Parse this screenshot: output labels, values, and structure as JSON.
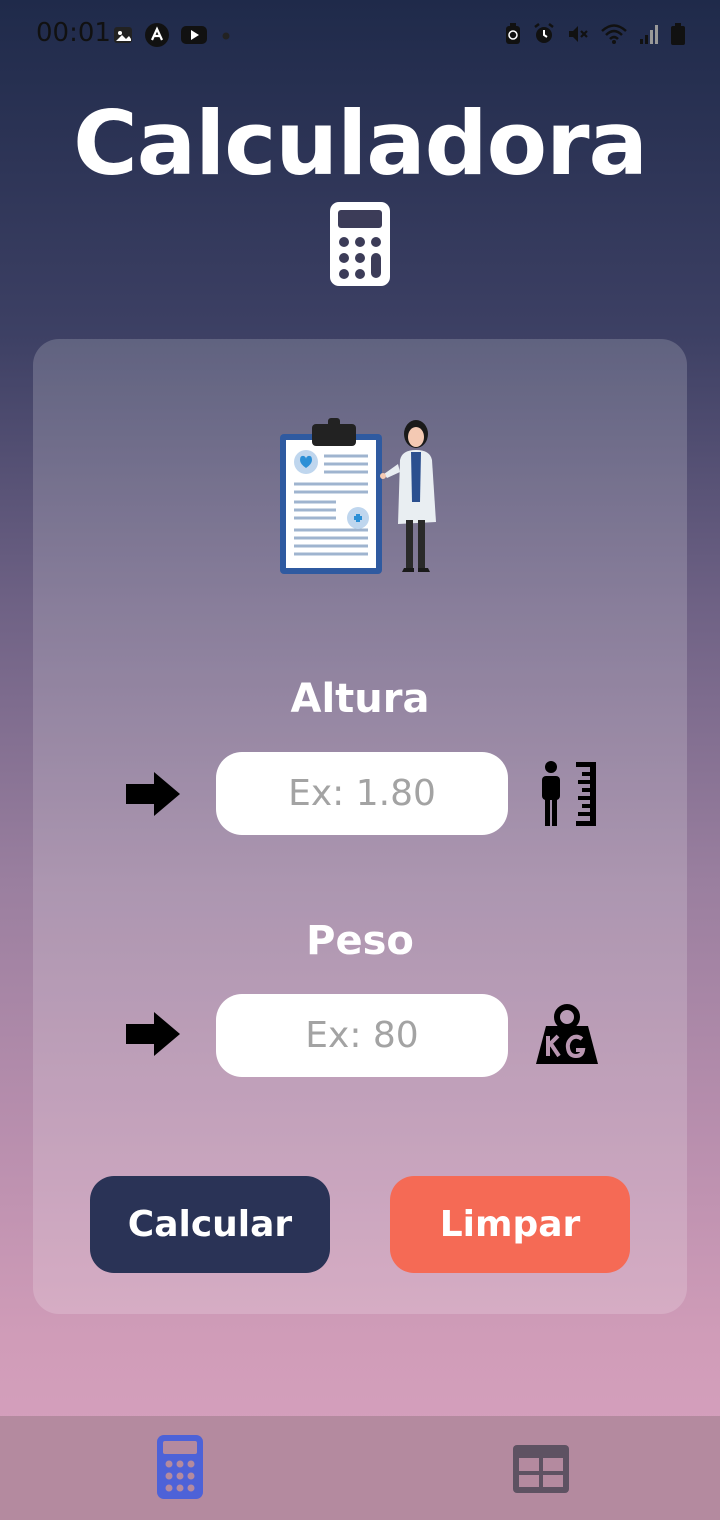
{
  "status_bar": {
    "time": "00:01",
    "left_icons": [
      "gallery-icon",
      "app-icon",
      "youtube-icon",
      "dot-icon"
    ],
    "right_icons": [
      "battery-saver-icon",
      "alarm-icon",
      "mute-icon",
      "wifi-icon",
      "signal-icon",
      "battery-icon"
    ]
  },
  "header": {
    "title": "Calculadora",
    "icon": "calculator-icon"
  },
  "form": {
    "height": {
      "label": "Altura",
      "placeholder": "Ex: 1.80",
      "value": "",
      "icon": "height-measure-icon"
    },
    "weight": {
      "label": "Peso",
      "placeholder": "Ex: 80",
      "value": "",
      "icon": "kg-weight-icon"
    }
  },
  "buttons": {
    "calculate": "Calcular",
    "clear": "Limpar"
  },
  "colors": {
    "calculate_button": "#2a3356",
    "clear_button": "#f56a55",
    "nav_active": "#4d62d8",
    "nav_inactive": "#5e5262"
  },
  "bottom_nav": [
    {
      "name": "calculator-tab",
      "icon": "calculator-icon",
      "active": true
    },
    {
      "name": "table-tab",
      "icon": "table-icon",
      "active": false
    }
  ]
}
